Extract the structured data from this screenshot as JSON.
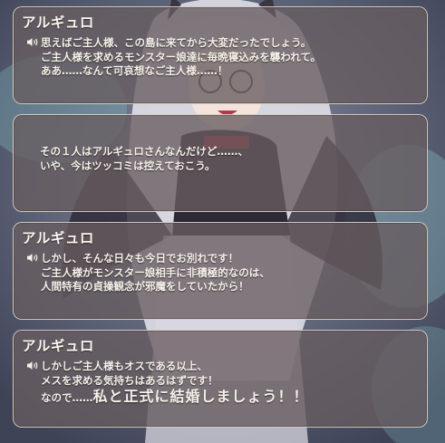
{
  "dialogue_boxes": [
    {
      "speaker": "アルギュロ",
      "has_voice_icon": true,
      "lines": [
        "思えばご主人様、この島に来てから大変だったでしょう。",
        "ご主人様を求めるモンスター娘達に毎晩寝込みを襲われて。",
        "ああ……なんて可哀想なご主人様……！"
      ]
    },
    {
      "speaker": "",
      "has_voice_icon": false,
      "lines": [
        "その１人はアルギュロさんなんだけど……、",
        "いや、今はツッコミは控えておこう。"
      ]
    },
    {
      "speaker": "アルギュロ",
      "has_voice_icon": true,
      "lines": [
        "しかし、そんな日々も今日でお別れです！",
        "ご主人様がモンスター娘相手に非積極的なのは、",
        "人間特有の貞操観念が邪魔をしていたから！"
      ]
    },
    {
      "speaker": "アルギュロ",
      "has_voice_icon": true,
      "lines": [
        "しかしご主人様もオスである以上、",
        "メスを求める気持ちはあるはずです！"
      ],
      "last_line_prefix": "なので……",
      "last_line_emphasis": "私と正式に結婚しましょう！！"
    }
  ],
  "icons": {
    "voice": "speaker-voice-icon"
  },
  "colors": {
    "box_fill": "#685c60",
    "box_border": "#e6dccd",
    "text": "#f6f2ea"
  }
}
